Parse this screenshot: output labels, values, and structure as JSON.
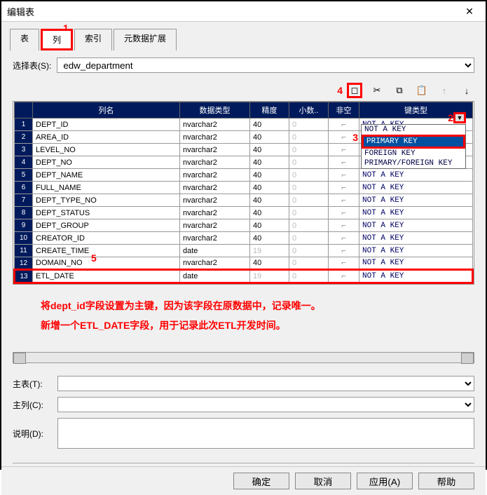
{
  "window": {
    "title": "编辑表"
  },
  "tabs": {
    "items": [
      "表",
      "列",
      "索引",
      "元数据扩展"
    ],
    "active": 1
  },
  "selector": {
    "label": "选择表(S):",
    "value": "edw_department"
  },
  "toolbar": {
    "icons": {
      "new": "◻",
      "cut": "✂",
      "copy": "⧉",
      "paste": "📋",
      "up": "↑",
      "down": "↓"
    }
  },
  "grid": {
    "headers": [
      "列名",
      "数据类型",
      "精度",
      "小数..",
      "非空",
      "键类型"
    ],
    "rows": [
      {
        "n": 1,
        "name": "DEPT_ID",
        "type": "nvarchar2",
        "prec": "40",
        "scale": "0",
        "nn": "",
        "key": "NOT A KEY"
      },
      {
        "n": 2,
        "name": "AREA_ID",
        "type": "nvarchar2",
        "prec": "40",
        "scale": "0",
        "nn": "",
        "key": ""
      },
      {
        "n": 3,
        "name": "LEVEL_NO",
        "type": "nvarchar2",
        "prec": "40",
        "scale": "0",
        "nn": "",
        "key": ""
      },
      {
        "n": 4,
        "name": "DEPT_NO",
        "type": "nvarchar2",
        "prec": "40",
        "scale": "0",
        "nn": "",
        "key": ""
      },
      {
        "n": 5,
        "name": "DEPT_NAME",
        "type": "nvarchar2",
        "prec": "40",
        "scale": "0",
        "nn": "",
        "key": "NOT A KEY"
      },
      {
        "n": 6,
        "name": "FULL_NAME",
        "type": "nvarchar2",
        "prec": "40",
        "scale": "0",
        "nn": "",
        "key": "NOT A KEY"
      },
      {
        "n": 7,
        "name": "DEPT_TYPE_NO",
        "type": "nvarchar2",
        "prec": "40",
        "scale": "0",
        "nn": "",
        "key": "NOT A KEY"
      },
      {
        "n": 8,
        "name": "DEPT_STATUS",
        "type": "nvarchar2",
        "prec": "40",
        "scale": "0",
        "nn": "",
        "key": "NOT A KEY"
      },
      {
        "n": 9,
        "name": "DEPT_GROUP",
        "type": "nvarchar2",
        "prec": "40",
        "scale": "0",
        "nn": "",
        "key": "NOT A KEY"
      },
      {
        "n": 10,
        "name": "CREATOR_ID",
        "type": "nvarchar2",
        "prec": "40",
        "scale": "0",
        "nn": "",
        "key": "NOT A KEY"
      },
      {
        "n": 11,
        "name": "CREATE_TIME",
        "type": "date",
        "prec": "19",
        "scale": "0",
        "nn": "",
        "key": "NOT A KEY"
      },
      {
        "n": 12,
        "name": "DOMAIN_NO",
        "type": "nvarchar2",
        "prec": "40",
        "scale": "0",
        "nn": "",
        "key": "NOT A KEY"
      },
      {
        "n": 13,
        "name": "ETL_DATE",
        "type": "date",
        "prec": "19",
        "scale": "0",
        "nn": "",
        "key": "NOT A KEY"
      }
    ]
  },
  "dropdown": {
    "options": [
      "NOT A KEY",
      "PRIMARY KEY",
      "FOREIGN KEY",
      "PRIMARY/FOREIGN KEY"
    ],
    "selected": 1
  },
  "annotations": {
    "a1": "1",
    "a2": "2",
    "a3": "3",
    "a4": "4",
    "a5": "5"
  },
  "notes": {
    "line1": "将dept_id字段设置为主键，因为该字段在原数据中，记录唯一。",
    "line2": "新增一个ETL_DATE字段，用于记录此次ETL开发时间。"
  },
  "bottom": {
    "main_table": "主表(T):",
    "main_col": "主列(C):",
    "desc": "说明(D):"
  },
  "footer": {
    "ok": "确定",
    "cancel": "取消",
    "apply": "应用(A)",
    "help": "帮助"
  }
}
